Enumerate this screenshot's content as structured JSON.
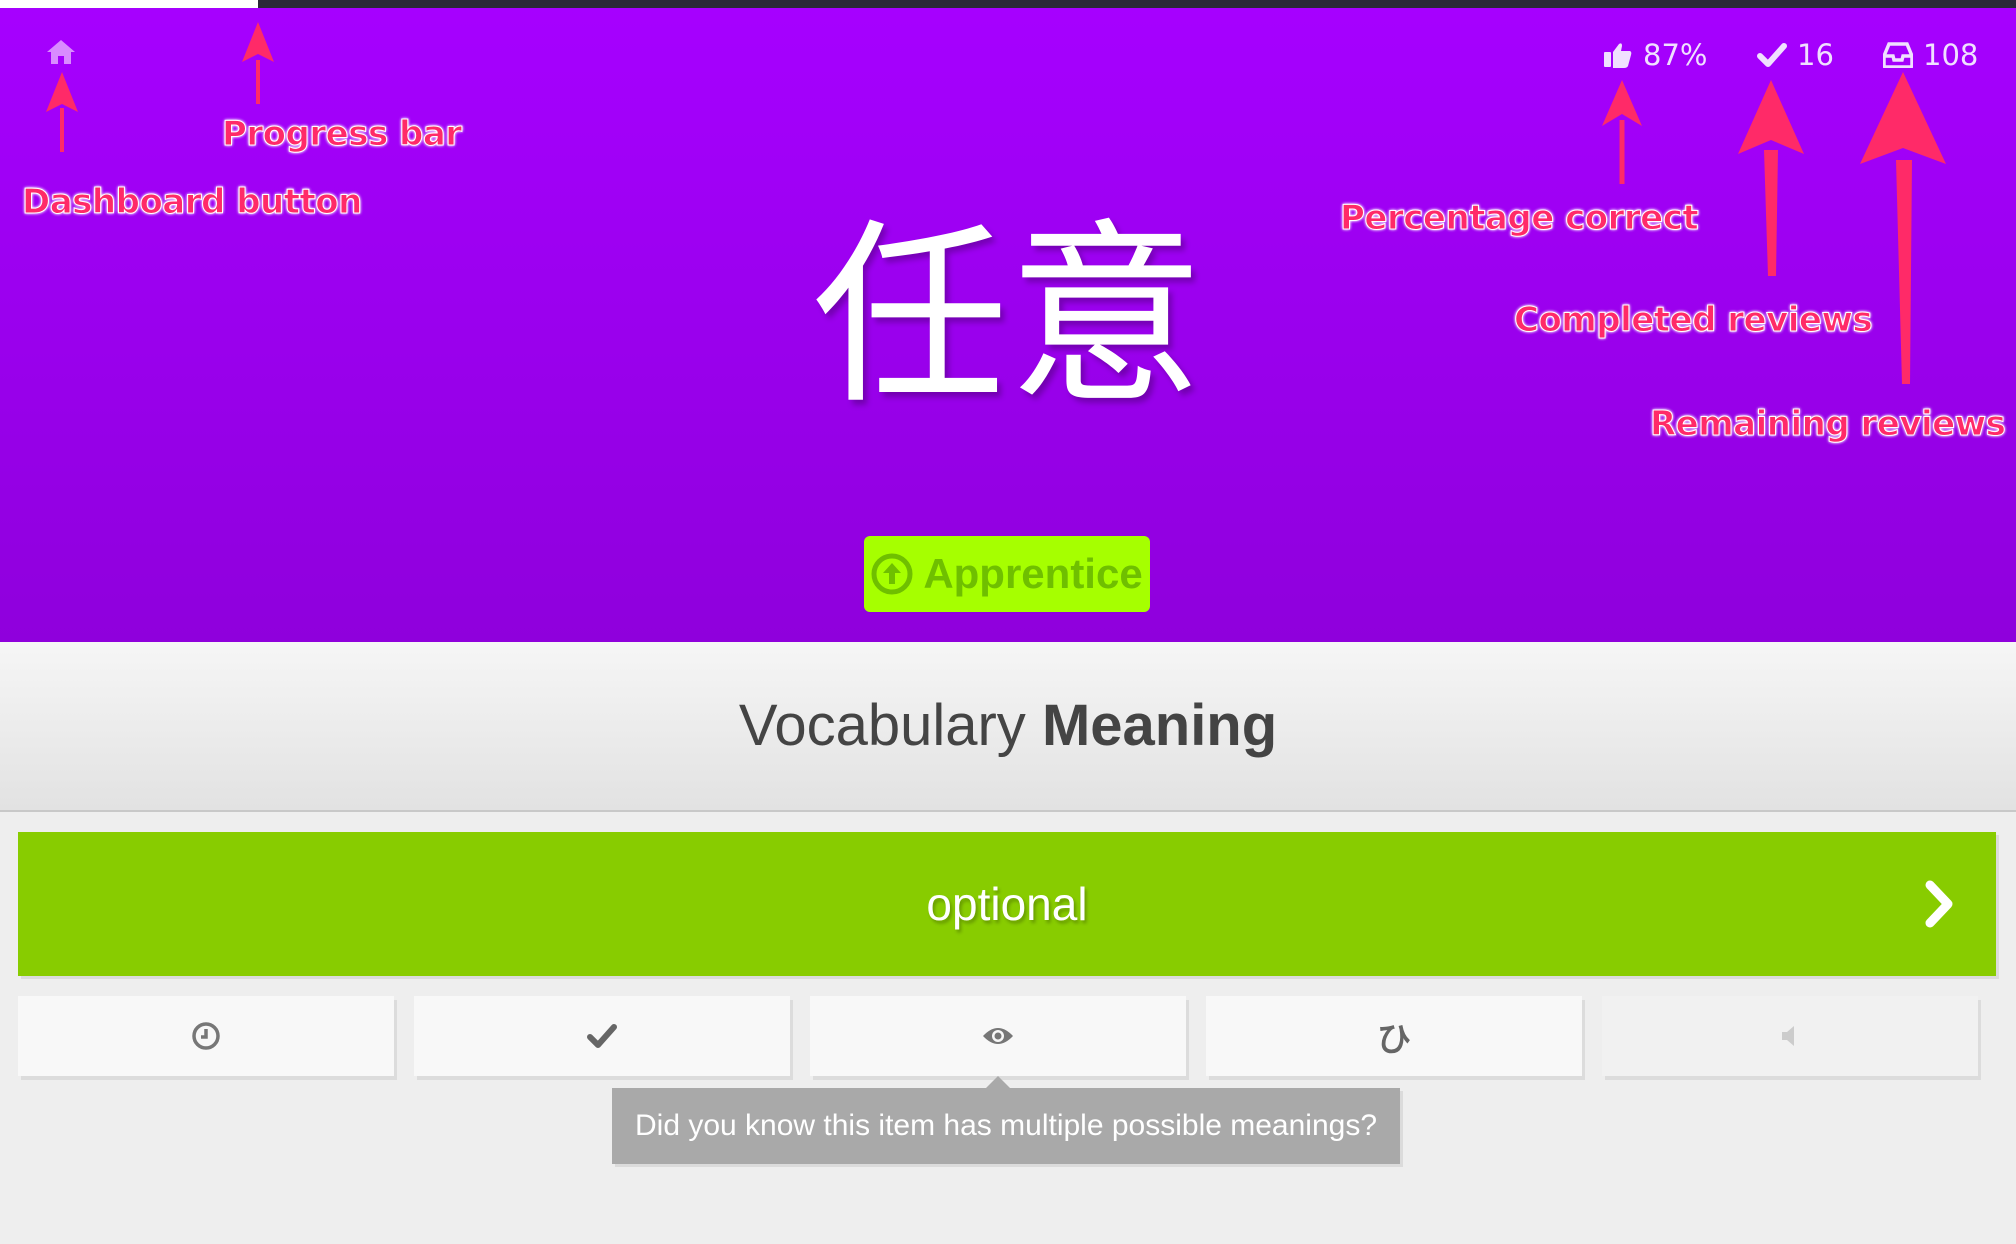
{
  "progress": {
    "fraction": 0.128
  },
  "header": {
    "stats": {
      "percent_correct": "87%",
      "completed": "16",
      "remaining": "108"
    },
    "character": "任意",
    "srs_level": "Apprentice"
  },
  "question": {
    "type_prefix": "Vocabulary",
    "type_suffix": "Meaning"
  },
  "answer": {
    "value": "optional"
  },
  "item_buttons": [
    {
      "icon": "clock-icon"
    },
    {
      "icon": "check-icon"
    },
    {
      "icon": "eye-icon"
    },
    {
      "icon": "kana-icon",
      "glyph": "ひ"
    },
    {
      "icon": "speaker-icon"
    }
  ],
  "tooltip": "Did you know this item has multiple possible meanings?",
  "annotations": {
    "dashboard": "Dashboard button",
    "progress": "Progress bar",
    "percentage": "Percentage correct",
    "completed": "Completed reviews",
    "remaining": "Remaining reviews"
  },
  "colors": {
    "header": "#a600ff",
    "badge": "#a6ff00",
    "answer_correct": "#88cc00",
    "annotation": "#ff2a68"
  }
}
